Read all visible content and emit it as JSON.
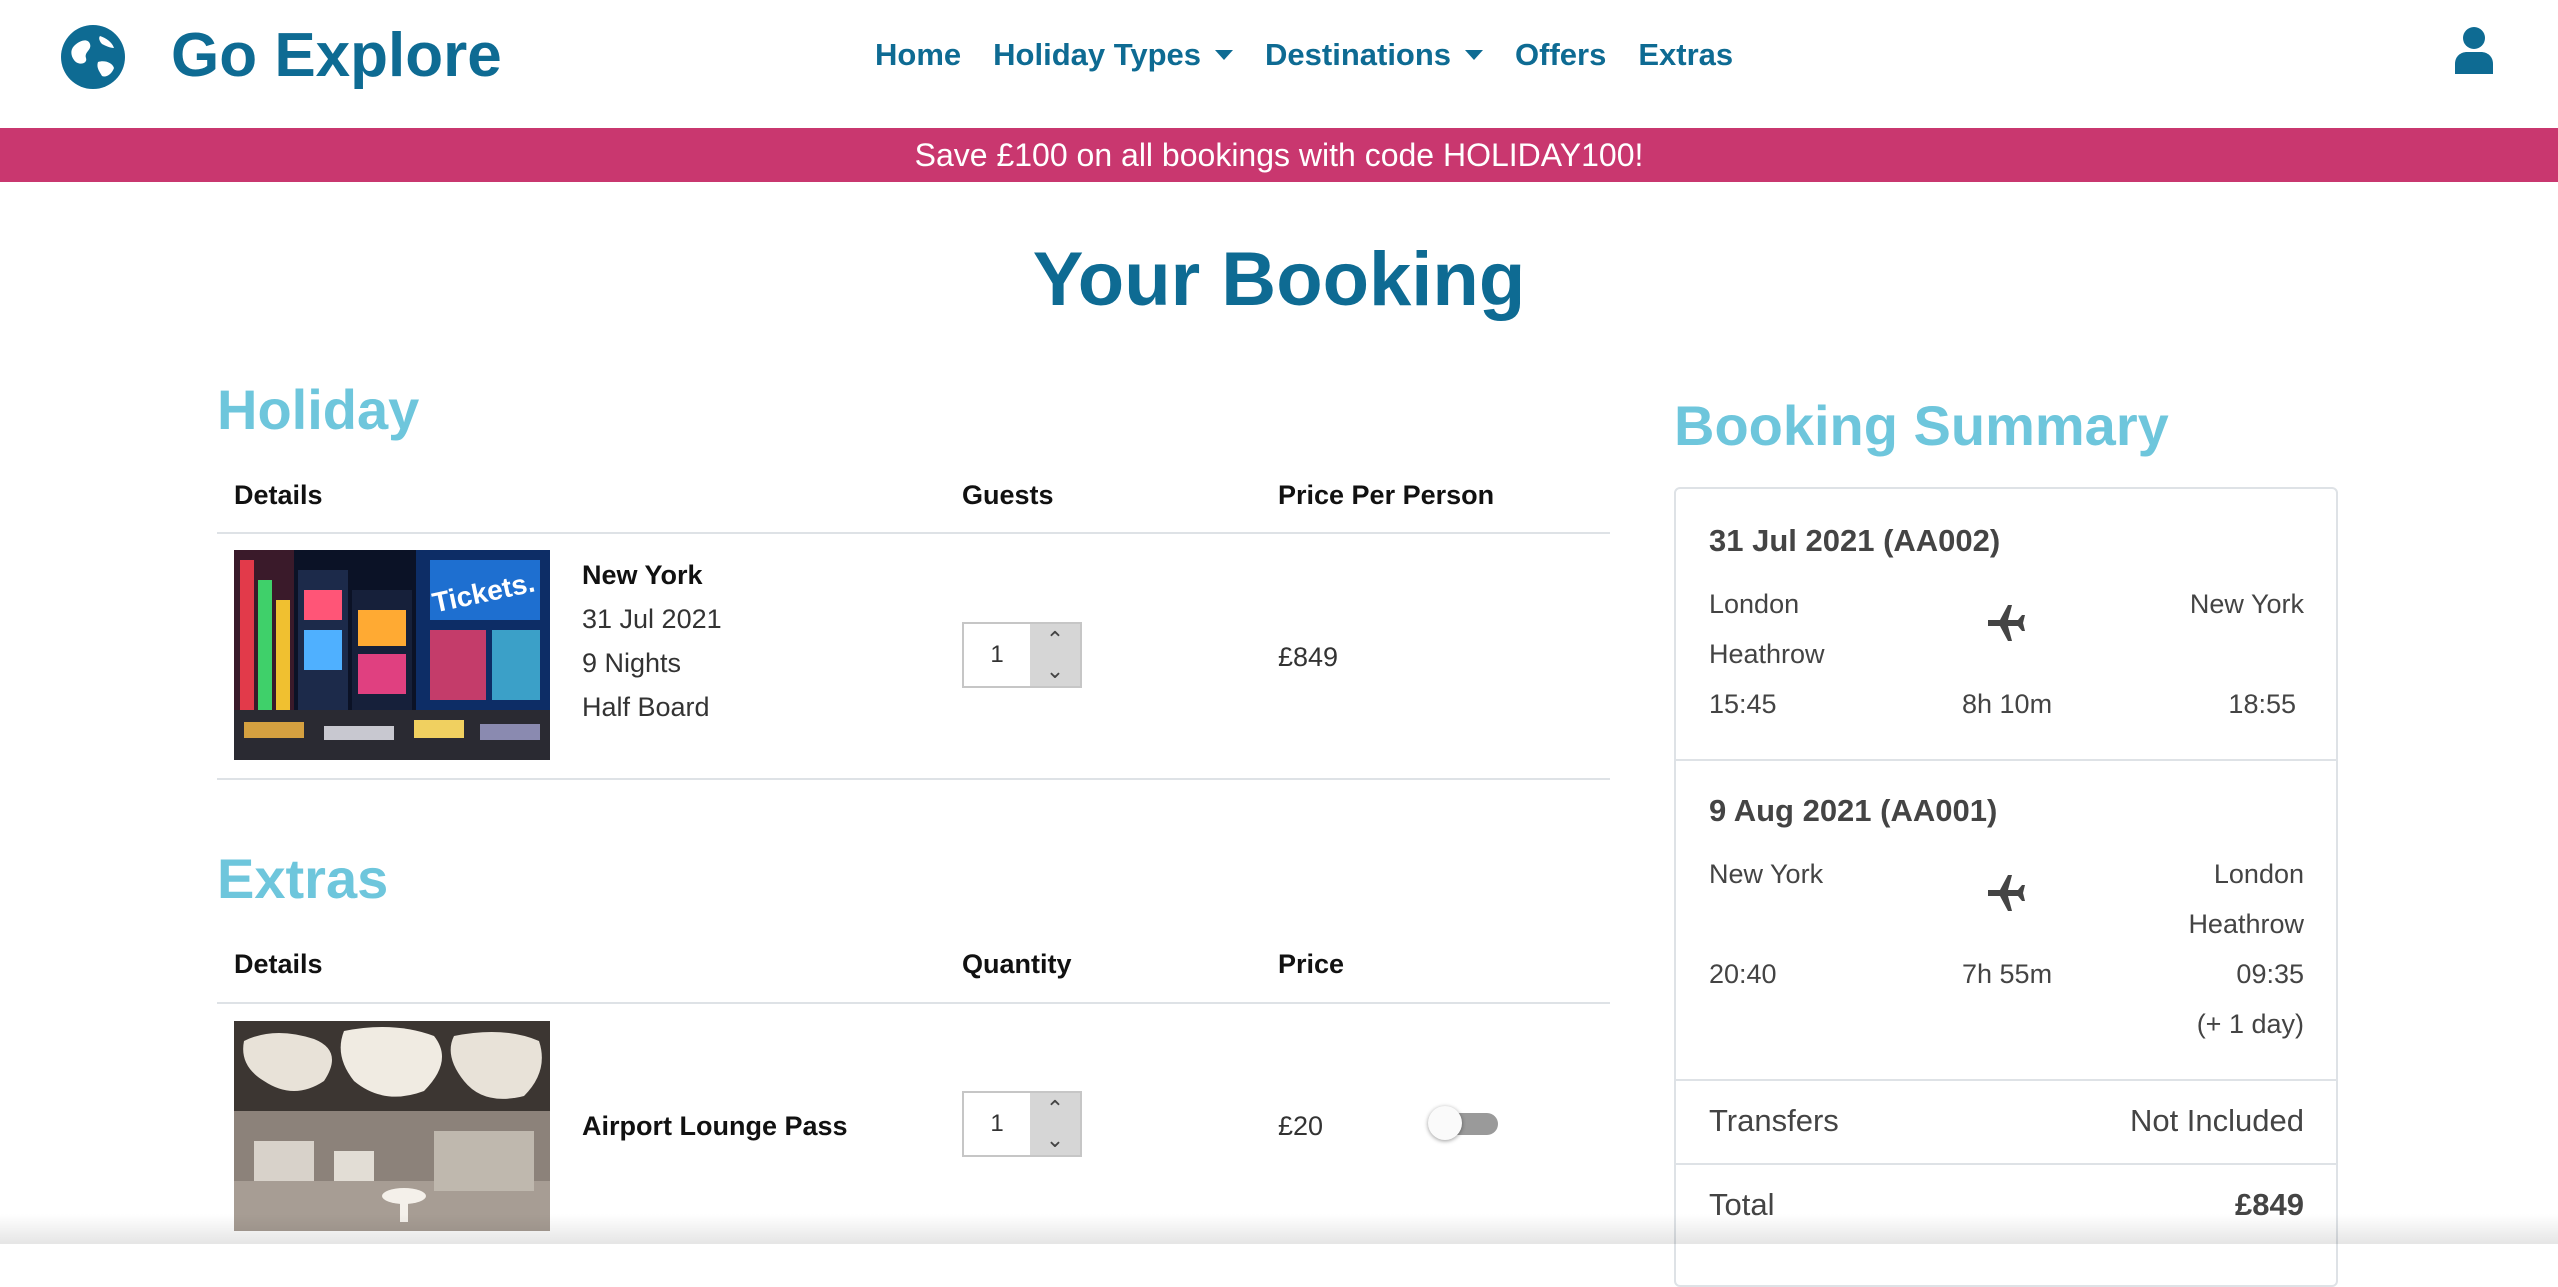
{
  "header": {
    "brand": "Go Explore",
    "nav": [
      {
        "label": "Home"
      },
      {
        "label": "Holiday Types"
      },
      {
        "label": "Destinations"
      },
      {
        "label": "Offers"
      },
      {
        "label": "Extras"
      }
    ],
    "brand_color": "#0e6b93"
  },
  "promo": {
    "text": "Save £100 on all bookings with code HOLIDAY100!",
    "color": "#c9376f"
  },
  "page": {
    "title": "Your Booking"
  },
  "holiday": {
    "section_title": "Holiday",
    "headers": {
      "details": "Details",
      "guests": "Guests",
      "price": "Price Per Person"
    },
    "item": {
      "name": "New York",
      "date": "31 Jul 2021",
      "nights": "9 Nights",
      "board": "Half Board",
      "guests": "1",
      "price": "£849",
      "image": "times-square-night-photo"
    }
  },
  "extras": {
    "section_title": "Extras",
    "headers": {
      "details": "Details",
      "quantity": "Quantity",
      "price": "Price"
    },
    "item": {
      "name": "Airport Lounge Pass",
      "quantity": "1",
      "price": "£20",
      "toggle_on": false,
      "image": "airport-lounge-photo"
    }
  },
  "summary": {
    "title": "Booking Summary",
    "outbound": {
      "date": "31 Jul 2021 (AA002)",
      "from_line1": "London",
      "from_line2": "Heathrow",
      "to": "New York",
      "depart": "15:45",
      "duration": "8h 10m",
      "arrive": "18:55"
    },
    "return": {
      "date": "9 Aug 2021 (AA001)",
      "from": "New York",
      "to_line1": "London",
      "to_line2": "Heathrow",
      "depart": "20:40",
      "duration": "7h 55m",
      "arrive": "09:35",
      "arrive_note": "(+ 1 day)"
    },
    "transfers_label": "Transfers",
    "transfers_value": "Not Included",
    "total_label": "Total",
    "total_value": "£849"
  }
}
